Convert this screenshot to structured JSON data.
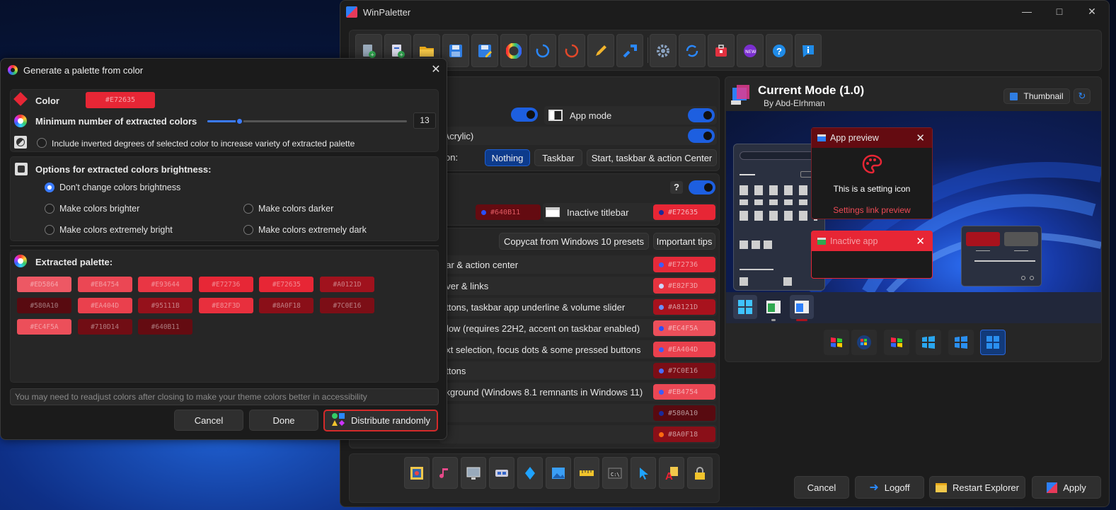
{
  "main_window": {
    "title": "WinPaletter",
    "theme": {
      "name": "Current Mode (1.0)",
      "author": "By Abd-Elrhman"
    },
    "thumbnail_label": "Thumbnail",
    "settings_rows": {
      "app_mode_label": "App mode",
      "transparency_partial": "/Acrylic)",
      "accent_on_partial": "on:",
      "accent_options": [
        "Nothing",
        "Taskbar",
        "Start, taskbar & action Center"
      ],
      "help_mark": "?",
      "active_titlebar_color": "#640B11",
      "inactive_titlebar_label": "Inactive titlebar",
      "inactive_titlebar_color": "#E72635"
    },
    "copycat_button": "Copycat from Windows 10 presets",
    "tips_button": "Important tips",
    "color_rows": [
      {
        "label": "bar & action center",
        "value": "#E72736",
        "bg": "#e52a39",
        "dot": "#3d5cff"
      },
      {
        "label": "over & links",
        "value": "#E82F3D",
        "bg": "#e6333f",
        "dot": "#cfd6ff"
      },
      {
        "label": "uttons, taskbar app underline & volume slider",
        "value": "#A8121D",
        "bg": "#a8121d",
        "dot": "#6a90ff"
      },
      {
        "label": "rflow (requires 22H2, accent on taskbar enabled)",
        "value": "#EC4F5A",
        "bg": "#ec4f5a",
        "dot": "#2a4fff"
      },
      {
        "label": "ext selection, focus dots & some pressed buttons",
        "value": "#EA404D",
        "bg": "#ea404d",
        "dot": "#3a5cff"
      },
      {
        "label": "uttons",
        "value": "#7C0E16",
        "bg": "#7c0e16",
        "dot": "#4a6dff"
      },
      {
        "label": "ckground (Windows 8.1 remnants in Windows 11)",
        "value": "#EB4754",
        "bg": "#eb4754",
        "dot": "#3a5cff"
      },
      {
        "label": "",
        "value": "#580A10",
        "bg": "#580a10",
        "dot": "#1a2a9a"
      },
      {
        "label": "",
        "value": "#8A0F18",
        "bg": "#8a0f18",
        "dot": "#ff6a10"
      }
    ],
    "preview": {
      "app_preview_title": "App preview",
      "setting_icon_text": "This is a setting icon",
      "settings_link": "Settings link preview",
      "inactive_app_title": "Inactive app"
    },
    "footer_buttons": {
      "cancel": "Cancel",
      "logoff": "Logoff",
      "restart": "Restart Explorer",
      "apply": "Apply"
    },
    "toolbar_icons": [
      "new-from-current-icon",
      "new-from-default-icon",
      "open-icon",
      "save-icon",
      "save-as-icon",
      "color-wheel-icon",
      "reset-icon",
      "restore-icon",
      "edit-icon",
      "export-icon",
      "settings-icon",
      "update-icon",
      "store-icon",
      "whats-new-icon",
      "help-icon",
      "about-icon"
    ],
    "new_badge": "NEW",
    "bottom_icons": [
      "wallpaper-icon",
      "sounds-icon",
      "screensaver-icon",
      "metrics-icon",
      "accessibility-icon",
      "images-icon",
      "ruler-icon",
      "cmd-icon",
      "cursor-icon",
      "fonts-icon",
      "lock-icon"
    ],
    "cmd_text": "C:\\",
    "os_icons": [
      "windows-xp-icon",
      "windows-vista-icon",
      "windows-7-icon",
      "windows-8-icon",
      "windows-10-icon",
      "windows-11-icon"
    ]
  },
  "dialog": {
    "title": "Generate a palette from color",
    "color_label": "Color",
    "color_value": "#E72635",
    "min_colors_label": "Minimum number of extracted colors",
    "min_colors_value": "13",
    "slider_fraction": 0.16,
    "invert_label": "Include inverted degrees of selected color to increase variety of extracted palette",
    "brightness_heading": "Options for extracted colors brightness:",
    "brightness_options": [
      "Don't change colors brightness",
      "Make colors brighter",
      "Make colors darker",
      "Make colors extremely bright",
      "Make colors extremely dark"
    ],
    "palette_heading": "Extracted palette:",
    "palette": [
      {
        "hex": "#ED5864",
        "bg": "#ed5864"
      },
      {
        "hex": "#EB4754",
        "bg": "#eb4754"
      },
      {
        "hex": "#E93644",
        "bg": "#e93644"
      },
      {
        "hex": "#E72736",
        "bg": "#e72736"
      },
      {
        "hex": "#E72635",
        "bg": "#e72635"
      },
      {
        "hex": "#A0121D",
        "bg": "#a0121d"
      },
      {
        "hex": "#580A10",
        "bg": "#580a10"
      },
      {
        "hex": "#EA404D",
        "bg": "#ea404d"
      },
      {
        "hex": "#95111B",
        "bg": "#95111b"
      },
      {
        "hex": "#E82F3D",
        "bg": "#e82f3d"
      },
      {
        "hex": "#8A0F18",
        "bg": "#8a0f18"
      },
      {
        "hex": "#7C0E16",
        "bg": "#7c0e16"
      },
      {
        "hex": "#EC4F5A",
        "bg": "#ec4f5a"
      },
      {
        "hex": "#710D14",
        "bg": "#710d14"
      },
      {
        "hex": "#640B11",
        "bg": "#640b11"
      }
    ],
    "note": "You may need to readjust colors after closing to make your theme colors better in accessibility",
    "cancel": "Cancel",
    "done": "Done",
    "distribute": "Distribute randomly"
  },
  "colors": {
    "accent": "#1d5fe0",
    "highlight_border": "#d42a2a",
    "brand_red": "#e72635"
  }
}
